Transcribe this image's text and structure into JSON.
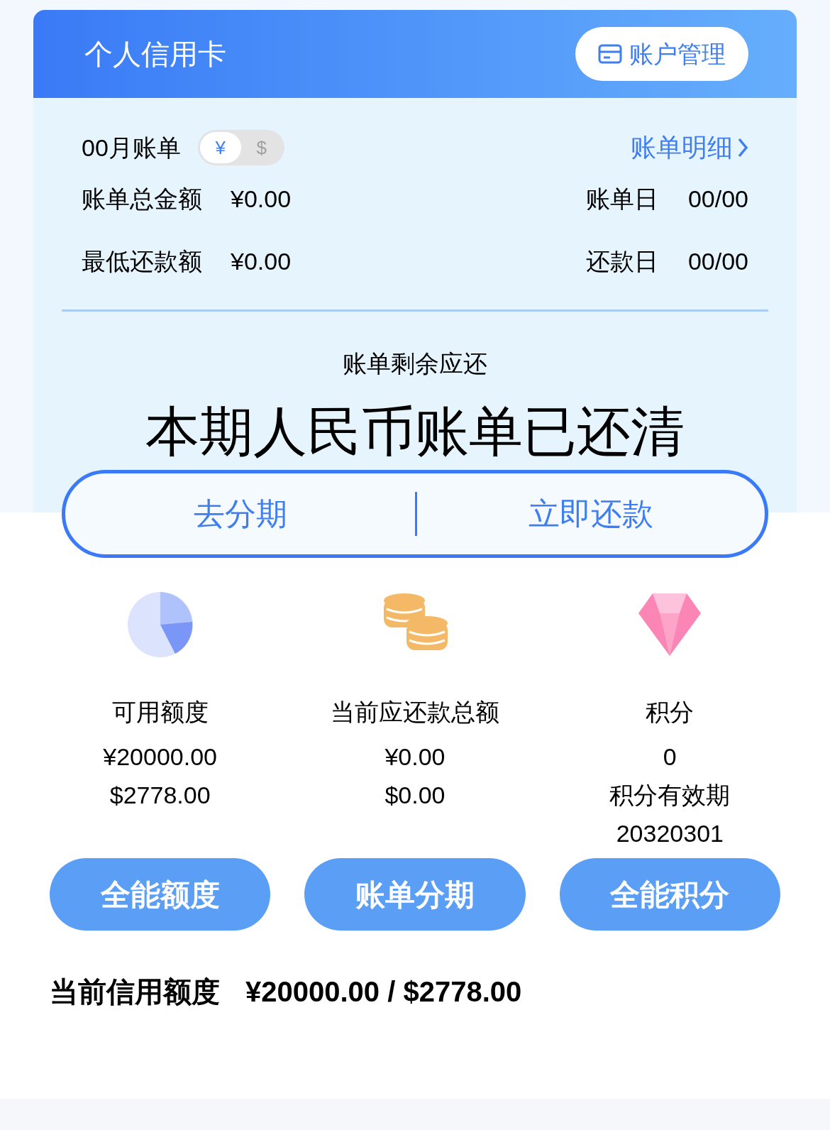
{
  "header": {
    "title": "个人信用卡",
    "account_button": "账户管理"
  },
  "bill": {
    "month": "00月账单",
    "currencies": [
      {
        "label": "¥",
        "selected": true
      },
      {
        "label": "$",
        "selected": false
      }
    ],
    "detail_link": "账单明细",
    "left_rows": [
      {
        "label": "账单总金额",
        "value": "¥0.00"
      },
      {
        "label": "最低还款额",
        "value": "¥0.00"
      }
    ],
    "right_rows": [
      {
        "label": "账单日",
        "value": "00/00"
      },
      {
        "label": "还款日",
        "value": "00/00"
      }
    ],
    "remaining_label": "账单剩余应还",
    "status": "本期人民币账单已还清",
    "actions": [
      "去分期",
      "立即还款"
    ]
  },
  "stats": [
    {
      "kind": "pie",
      "label": "可用额度",
      "lines": [
        "¥20000.00",
        "$2778.00"
      ],
      "button": "全能额度"
    },
    {
      "kind": "coins",
      "label": "当前应还款总额",
      "lines": [
        "¥0.00",
        "$0.00"
      ],
      "button": "账单分期"
    },
    {
      "kind": "diamond",
      "label": "积分",
      "lines": [
        "0",
        "积分有效期",
        "20320301"
      ],
      "button": "全能积分"
    }
  ],
  "credit_limit": {
    "label": "当前信用额度",
    "value": "¥20000.00 / $2778.00"
  }
}
